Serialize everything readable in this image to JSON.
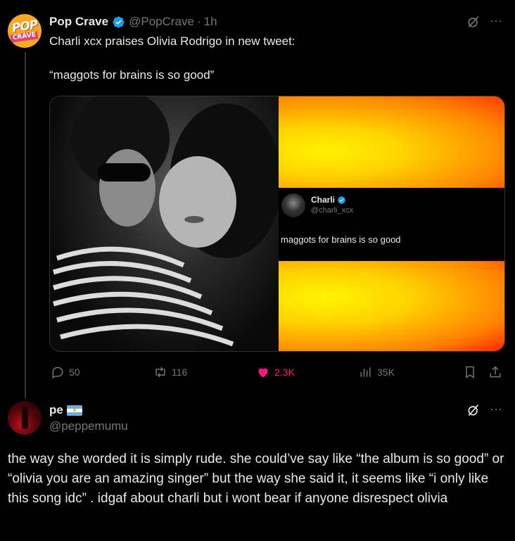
{
  "post": {
    "author_name": "Pop Crave",
    "author_handle": "@PopCrave",
    "separator": "·",
    "time": "1h",
    "avatar_text_top": "POP",
    "avatar_text_bottom": "CRAVE",
    "text_line1": "Charli xcx praises Olivia Rodrigo in new tweet:",
    "text_line2": "“maggots for brains is so good”",
    "more_label": "···",
    "embedded": {
      "name": "Charli",
      "handle": "@charli_xcx",
      "text": "maggots for brains is so good"
    },
    "actions": {
      "replies": "50",
      "reposts": "116",
      "likes": "2.3K",
      "views": "35K"
    }
  },
  "reply": {
    "author_name": "pe",
    "author_handle": "@peppemumu",
    "more_label": "···",
    "text": "the way she worded it is simply rude. she could’ve say like “the album is so good” or “olivia you are an amazing singer” but the way she said it, it seems like “i only like this song idc” . idgaf about charli but i wont bear if anyone disrespect olivia"
  },
  "colors": {
    "background": "#000000",
    "text_primary": "#e7e9ea",
    "text_secondary": "#71767b",
    "verified_blue": "#1d9bf0",
    "like_pink": "#f91880"
  },
  "icons": [
    "verified-badge-icon",
    "grok-icon",
    "more-icon",
    "reply-icon",
    "repost-icon",
    "like-icon",
    "views-icon",
    "bookmark-icon",
    "share-icon",
    "flag-argentina-icon"
  ]
}
